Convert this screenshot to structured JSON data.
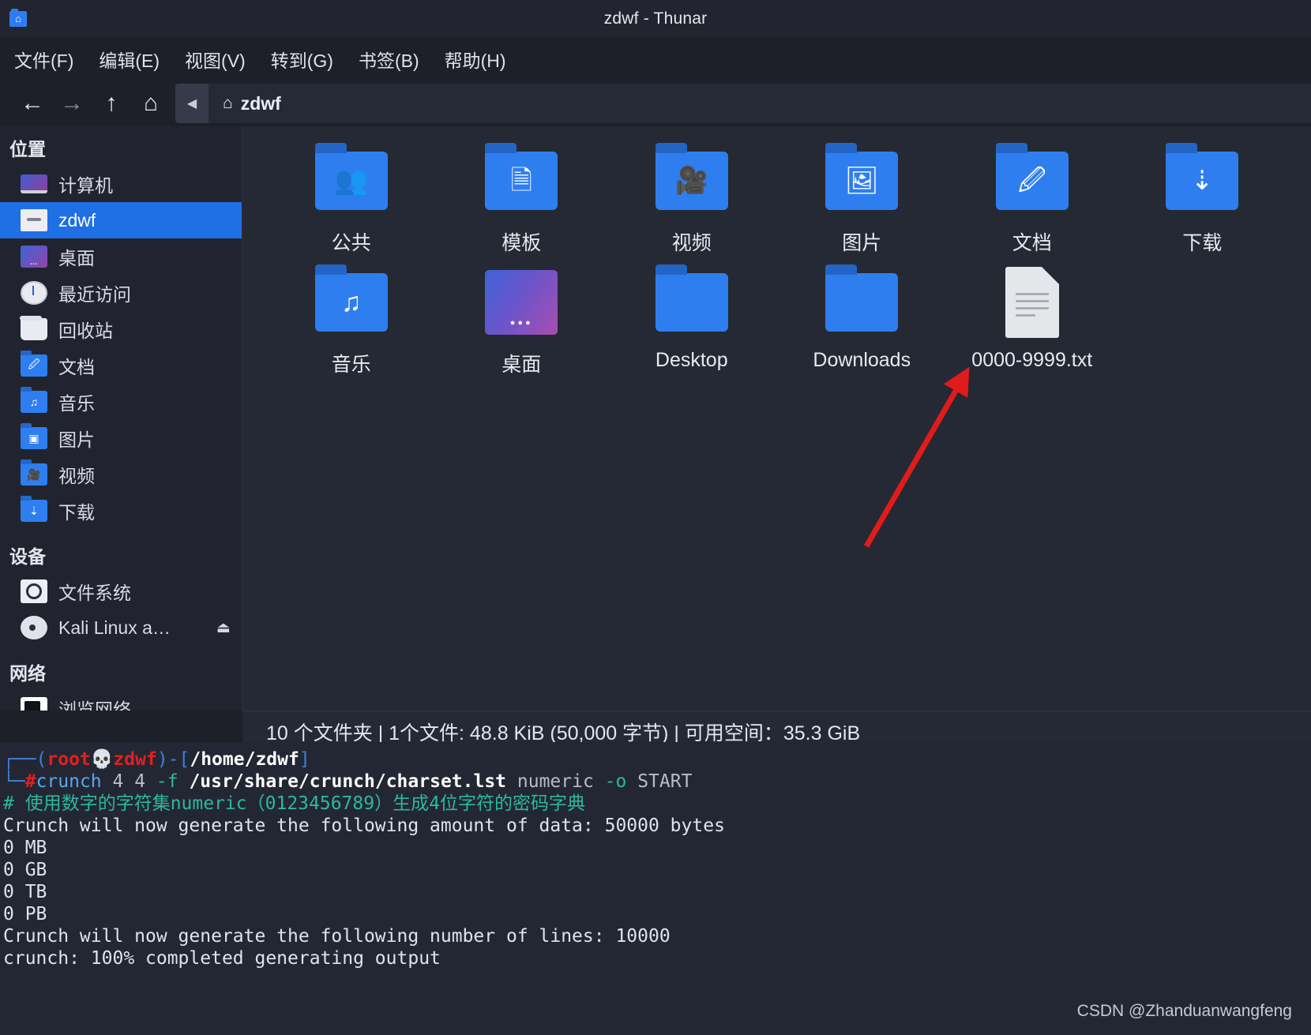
{
  "window": {
    "title": "zdwf - Thunar",
    "icon": "home-folder-icon"
  },
  "menubar": {
    "items": [
      {
        "label": "文件(F)",
        "name": "menu-file"
      },
      {
        "label": "编辑(E)",
        "name": "menu-edit"
      },
      {
        "label": "视图(V)",
        "name": "menu-view"
      },
      {
        "label": "转到(G)",
        "name": "menu-go"
      },
      {
        "label": "书签(B)",
        "name": "menu-bookmarks"
      },
      {
        "label": "帮助(H)",
        "name": "menu-help"
      }
    ]
  },
  "toolbar": {
    "back": "←",
    "forward": "→",
    "up": "↑",
    "home": "⌂",
    "path_scroll_left": "◀",
    "breadcrumb_home_icon": "⌂",
    "breadcrumb_label": "zdwf"
  },
  "sidebar": {
    "groups": [
      {
        "title": "位置",
        "name": "sidebar-group-places",
        "items": [
          {
            "label": "计算机",
            "icon": "computer-icon",
            "name": "sidebar-item-computer",
            "active": false
          },
          {
            "label": "zdwf",
            "icon": "home-folder-icon",
            "name": "sidebar-item-zdwf",
            "active": true
          },
          {
            "label": "桌面",
            "icon": "desktop-icon",
            "name": "sidebar-item-desktop",
            "active": false
          },
          {
            "label": "最近访问",
            "icon": "clock-icon",
            "name": "sidebar-item-recent",
            "active": false
          },
          {
            "label": "回收站",
            "icon": "trash-icon",
            "name": "sidebar-item-trash",
            "active": false
          },
          {
            "label": "文档",
            "icon": "documents-folder-icon",
            "name": "sidebar-item-documents",
            "active": false
          },
          {
            "label": "音乐",
            "icon": "music-folder-icon",
            "name": "sidebar-item-music",
            "active": false
          },
          {
            "label": "图片",
            "icon": "pictures-folder-icon",
            "name": "sidebar-item-pictures",
            "active": false
          },
          {
            "label": "视频",
            "icon": "videos-folder-icon",
            "name": "sidebar-item-videos",
            "active": false
          },
          {
            "label": "下载",
            "icon": "downloads-folder-icon",
            "name": "sidebar-item-downloads",
            "active": false
          }
        ]
      },
      {
        "title": "设备",
        "name": "sidebar-group-devices",
        "items": [
          {
            "label": "文件系统",
            "icon": "drive-icon",
            "name": "sidebar-item-filesystem",
            "active": false
          },
          {
            "label": "Kali Linux a…",
            "icon": "disc-icon",
            "name": "sidebar-item-kali-disc",
            "active": false,
            "eject": "⏏"
          }
        ]
      },
      {
        "title": "网络",
        "name": "sidebar-group-network",
        "items": [
          {
            "label": "浏览网络",
            "icon": "network-icon",
            "name": "sidebar-item-browse-network",
            "active": false
          }
        ]
      }
    ]
  },
  "files": [
    {
      "name": "公共",
      "type": "folder",
      "glyph": "👥",
      "icon": "public-folder-icon"
    },
    {
      "name": "模板",
      "type": "folder",
      "glyph": "🗎",
      "icon": "templates-folder-icon"
    },
    {
      "name": "视频",
      "type": "folder",
      "glyph": "🎥",
      "icon": "videos-folder-icon"
    },
    {
      "name": "图片",
      "type": "folder",
      "glyph": "🖼",
      "icon": "pictures-folder-icon"
    },
    {
      "name": "文档",
      "type": "folder",
      "glyph": "🖉",
      "icon": "documents-folder-icon"
    },
    {
      "name": "下载",
      "type": "folder",
      "glyph": "⇣",
      "icon": "downloads-folder-icon"
    },
    {
      "name": "音乐",
      "type": "folder",
      "glyph": "♫",
      "icon": "music-folder-icon"
    },
    {
      "name": "桌面",
      "type": "desktop",
      "glyph": "",
      "icon": "desktop-folder-icon"
    },
    {
      "name": "Desktop",
      "type": "folder",
      "glyph": "",
      "icon": "plain-folder-icon"
    },
    {
      "name": "Downloads",
      "type": "folder",
      "glyph": "",
      "icon": "plain-folder-icon"
    },
    {
      "name": "0000-9999.txt",
      "type": "textfile",
      "glyph": "",
      "icon": "text-file-icon"
    }
  ],
  "statusbar": {
    "text": "10 个文件夹 | 1个文件: 48.8 KiB (50,000 字节) | 可用空间：35.3 GiB"
  },
  "terminal": {
    "prompt_user": "root",
    "prompt_at": "💀",
    "prompt_host": "zdwf",
    "prompt_path": "/home/zdwf",
    "prompt_symbol": "#",
    "command_name": "crunch",
    "command_args": " 4 4 ",
    "command_flag_f": "-f",
    "command_path": " /usr/share/crunch/charset.lst ",
    "command_charset": "numeric ",
    "command_flag_o": "-o",
    "command_outfile": " START",
    "comment": "# 使用数字的字符集numeric（0123456789）生成4位字符的密码字典",
    "output_lines": [
      "Crunch will now generate the following amount of data: 50000 bytes",
      "0 MB",
      "0 GB",
      "0 TB",
      "0 PB",
      "Crunch will now generate the following number of lines: 10000",
      "",
      "crunch: 100% completed generating output"
    ]
  },
  "watermark": "CSDN @Zhanduanwangfeng",
  "colors": {
    "accent": "#1f6fe5",
    "folder": "#2e7ef0",
    "arrow": "#e01b1b",
    "window_bg": "#1d2029",
    "fileview_bg": "#252934"
  }
}
